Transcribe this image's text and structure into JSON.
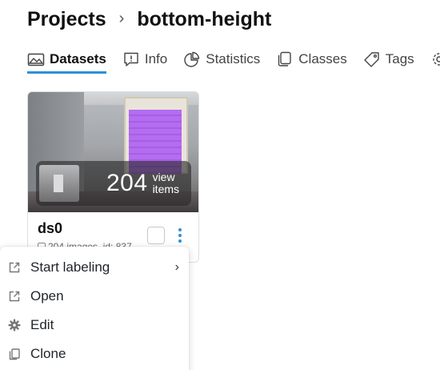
{
  "breadcrumb": {
    "root": "Projects",
    "separator": "›",
    "current": "bottom-height"
  },
  "tabs": [
    {
      "label": "Datasets",
      "icon": "images-icon",
      "active": true
    },
    {
      "label": "Info",
      "icon": "info-icon",
      "active": false
    },
    {
      "label": "Statistics",
      "icon": "pie-chart-icon",
      "active": false
    },
    {
      "label": "Classes",
      "icon": "layers-icon",
      "active": false
    },
    {
      "label": "Tags",
      "icon": "tag-icon",
      "active": false
    }
  ],
  "accent_color": "#2f8fd8",
  "dataset_card": {
    "name": "ds0",
    "meta": "204 images, id: 837",
    "count": "204",
    "view_line1": "view",
    "view_line2": "items",
    "highlight_color": "#b46cf0"
  },
  "context_menu": {
    "items": [
      {
        "label": "Start labeling",
        "icon": "external-link-icon",
        "submenu": "›"
      },
      {
        "label": "Open",
        "icon": "external-link-icon"
      },
      {
        "label": "Edit",
        "icon": "gear-icon"
      },
      {
        "label": "Clone",
        "icon": "copy-icon"
      }
    ]
  }
}
